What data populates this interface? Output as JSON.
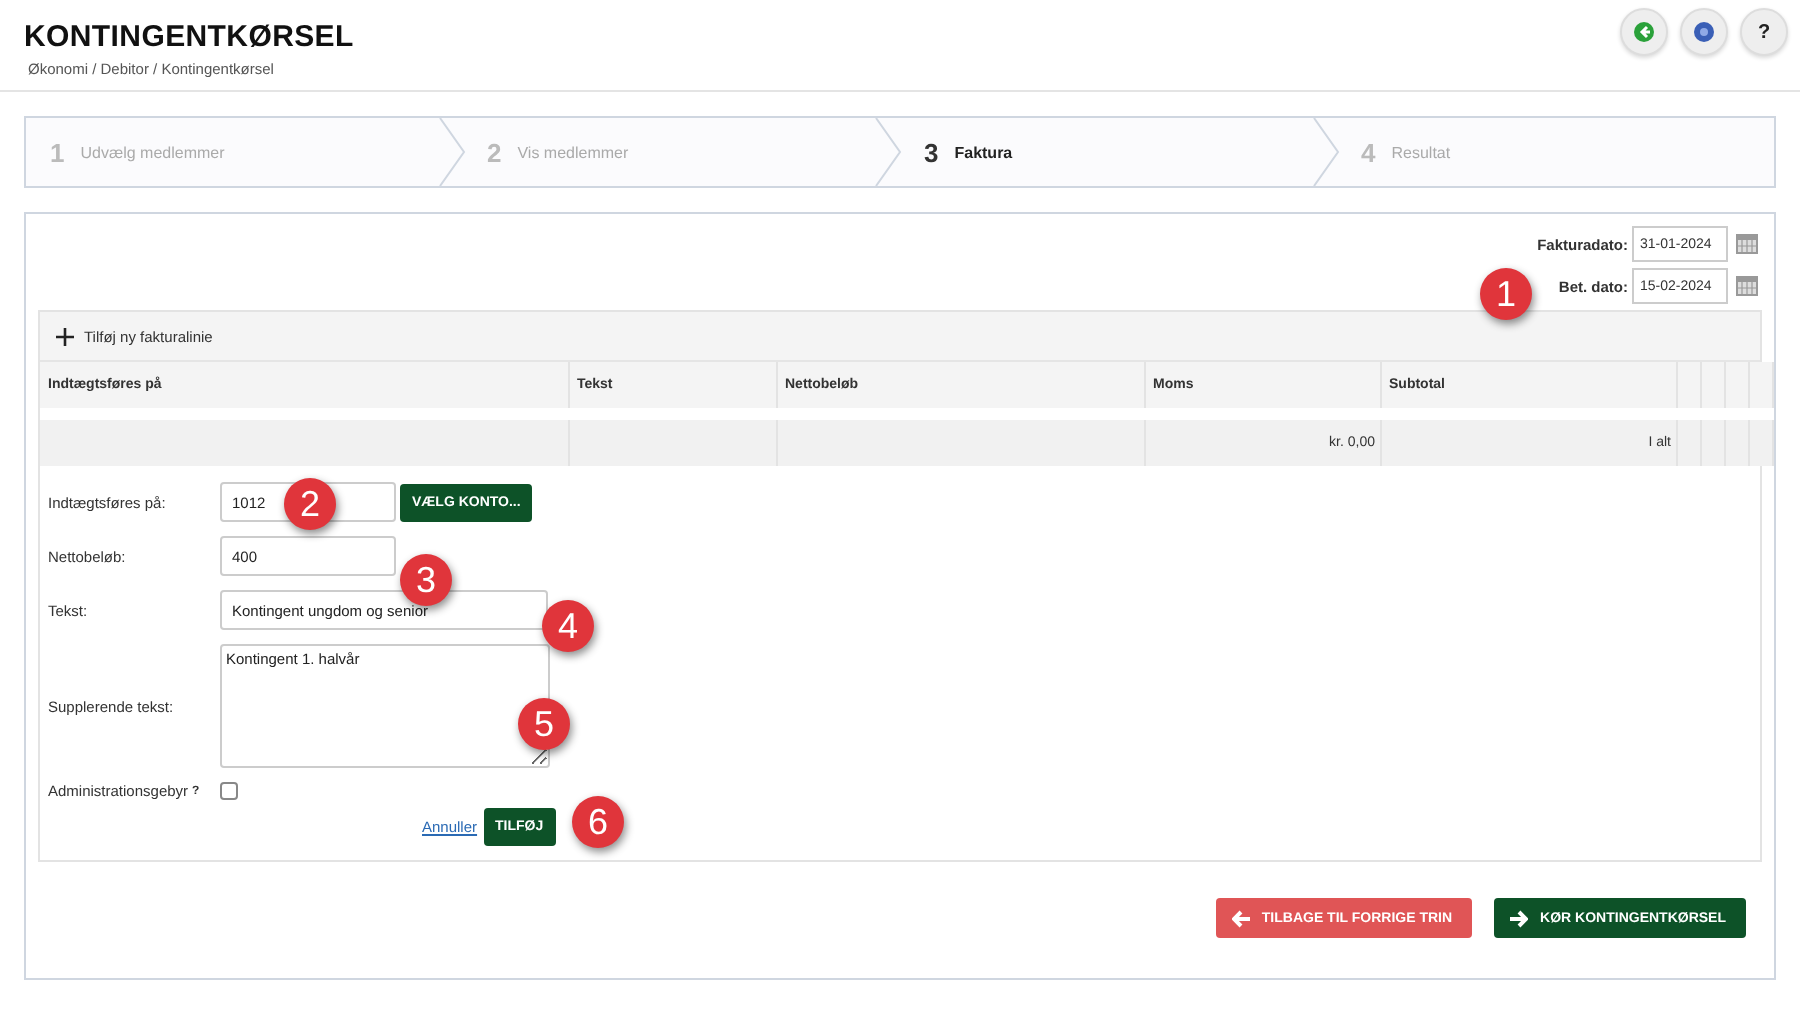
{
  "header": {
    "title": "KONTINGENTKØRSEL",
    "breadcrumb": "Økonomi / Debitor / Kontingentkørsel",
    "icon_buttons": [
      {
        "kind": "back"
      },
      {
        "kind": "info"
      },
      {
        "kind": "help",
        "label": "?"
      }
    ]
  },
  "steps": [
    {
      "number": "1",
      "label": "Udvælg medlemmer",
      "selected": false
    },
    {
      "number": "2",
      "label": "Vis medlemmer",
      "selected": false
    },
    {
      "number": "3",
      "label": "Faktura",
      "selected": true
    },
    {
      "number": "4",
      "label": "Resultat",
      "selected": false
    }
  ],
  "dates": [
    {
      "label": "Fakturadato:",
      "value": "31-01-2024"
    },
    {
      "label": "Bet. dato:",
      "value": "15-02-2024"
    }
  ],
  "add_line": "Tilføj ny fakturalinie",
  "table": {
    "columns": [
      "Indtægtsføres på",
      "Tekst",
      "Nettobeløb",
      "Moms",
      "Subtotal"
    ],
    "totals": {
      "moms": "kr. 0,00",
      "subtotal": "I alt"
    }
  },
  "form": {
    "account_label": "Indtægtsføres på:",
    "account_value": "1012",
    "account_button": "VÆLG KONTO...",
    "net_label": "Nettobeløb:",
    "net_value": "400",
    "text_label": "Tekst:",
    "text_value": "Kontingent ungdom og senior",
    "extra_label": "Supplerende tekst:",
    "extra_value": "Kontingent 1. halvår",
    "fee_label": "Administrationsgebyr",
    "fee_help": "?",
    "fee_checked": false,
    "cancel": "Annuller",
    "add": "TILFØJ"
  },
  "footer_buttons": [
    {
      "kind": "back",
      "label": "TILBAGE TIL FORRIGE TRIN"
    },
    {
      "kind": "run",
      "label": "KØR KONTINGENTKØRSEL"
    }
  ],
  "callouts": [
    "1",
    "2",
    "3",
    "4",
    "5",
    "6"
  ]
}
